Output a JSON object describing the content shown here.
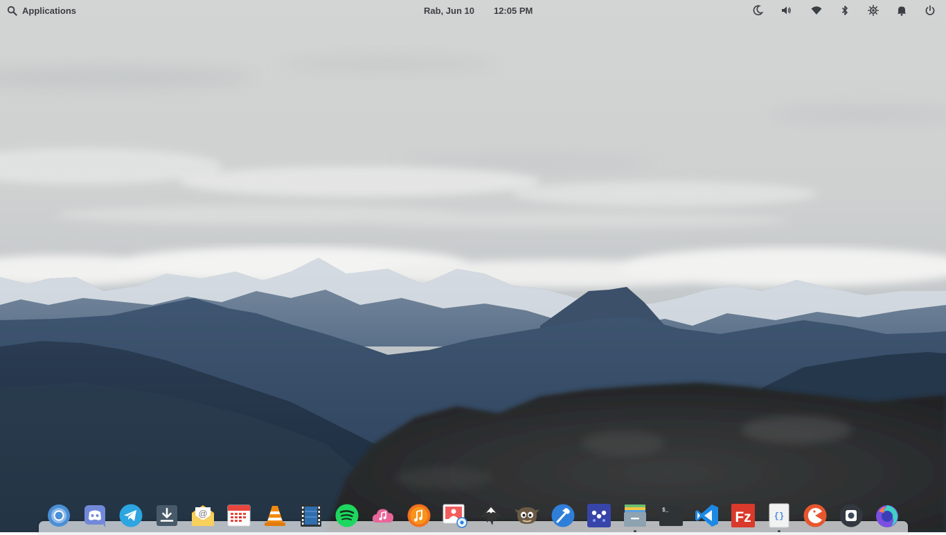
{
  "topbar": {
    "applications_label": "Applications",
    "date": "Rab, Jun 10",
    "time": "12:05 PM"
  },
  "indicators": [
    {
      "name": "night-light-icon"
    },
    {
      "name": "volume-icon"
    },
    {
      "name": "wifi-icon"
    },
    {
      "name": "bluetooth-icon"
    },
    {
      "name": "brightness-icon"
    },
    {
      "name": "notifications-icon"
    },
    {
      "name": "power-icon"
    }
  ],
  "dock": {
    "apps": [
      {
        "name": "chromium",
        "icon": "chromium-icon",
        "color": "#4a8fd6"
      },
      {
        "name": "discord",
        "icon": "discord-icon",
        "color": "#7289da"
      },
      {
        "name": "telegram",
        "icon": "telegram-icon",
        "color": "#2ca5e0"
      },
      {
        "name": "installer",
        "icon": "download-icon",
        "color": "#485a6a"
      },
      {
        "name": "mail",
        "icon": "mail-icon",
        "color": "#f5c542"
      },
      {
        "name": "calendar",
        "icon": "calendar-icon",
        "color": "#e8453c"
      },
      {
        "name": "vlc",
        "icon": "vlc-icon",
        "color": "#f28a10"
      },
      {
        "name": "videos",
        "icon": "film-icon",
        "color": "#2f6fb0"
      },
      {
        "name": "spotify",
        "icon": "spotify-icon",
        "color": "#1ed760"
      },
      {
        "name": "music-cloud",
        "icon": "music-cloud-icon",
        "color": "#e9669a"
      },
      {
        "name": "music",
        "icon": "music-icon",
        "color": "#f37020"
      },
      {
        "name": "photos",
        "icon": "photos-icon",
        "color": "#f25c5c"
      },
      {
        "name": "inkscape",
        "icon": "inkscape-icon",
        "color": "#333333"
      },
      {
        "name": "gimp",
        "icon": "gimp-icon",
        "color": "#6b5b46"
      },
      {
        "name": "code-builder",
        "icon": "hammer-icon",
        "color": "#2f7fd8"
      },
      {
        "name": "app-center",
        "icon": "app-center-icon",
        "color": "#3845a8"
      },
      {
        "name": "files",
        "icon": "files-icon",
        "color": "#8ea2b0"
      },
      {
        "name": "terminal",
        "icon": "terminal-icon",
        "color": "#2e3436"
      },
      {
        "name": "vscode",
        "icon": "vscode-icon",
        "color": "#1e88e5"
      },
      {
        "name": "filezilla",
        "icon": "filezilla-icon",
        "color": "#d93a2b"
      },
      {
        "name": "code-editor",
        "icon": "code-braces-icon",
        "color": "#f2f2f2"
      },
      {
        "name": "pacman",
        "icon": "pacman-icon",
        "color": "#e8562e"
      },
      {
        "name": "screenshot",
        "icon": "screenshot-icon",
        "color": "#333840"
      },
      {
        "name": "firefox",
        "icon": "firefox-icon",
        "color": "#7b4fe0"
      }
    ],
    "running": [
      "files",
      "code-editor"
    ]
  }
}
